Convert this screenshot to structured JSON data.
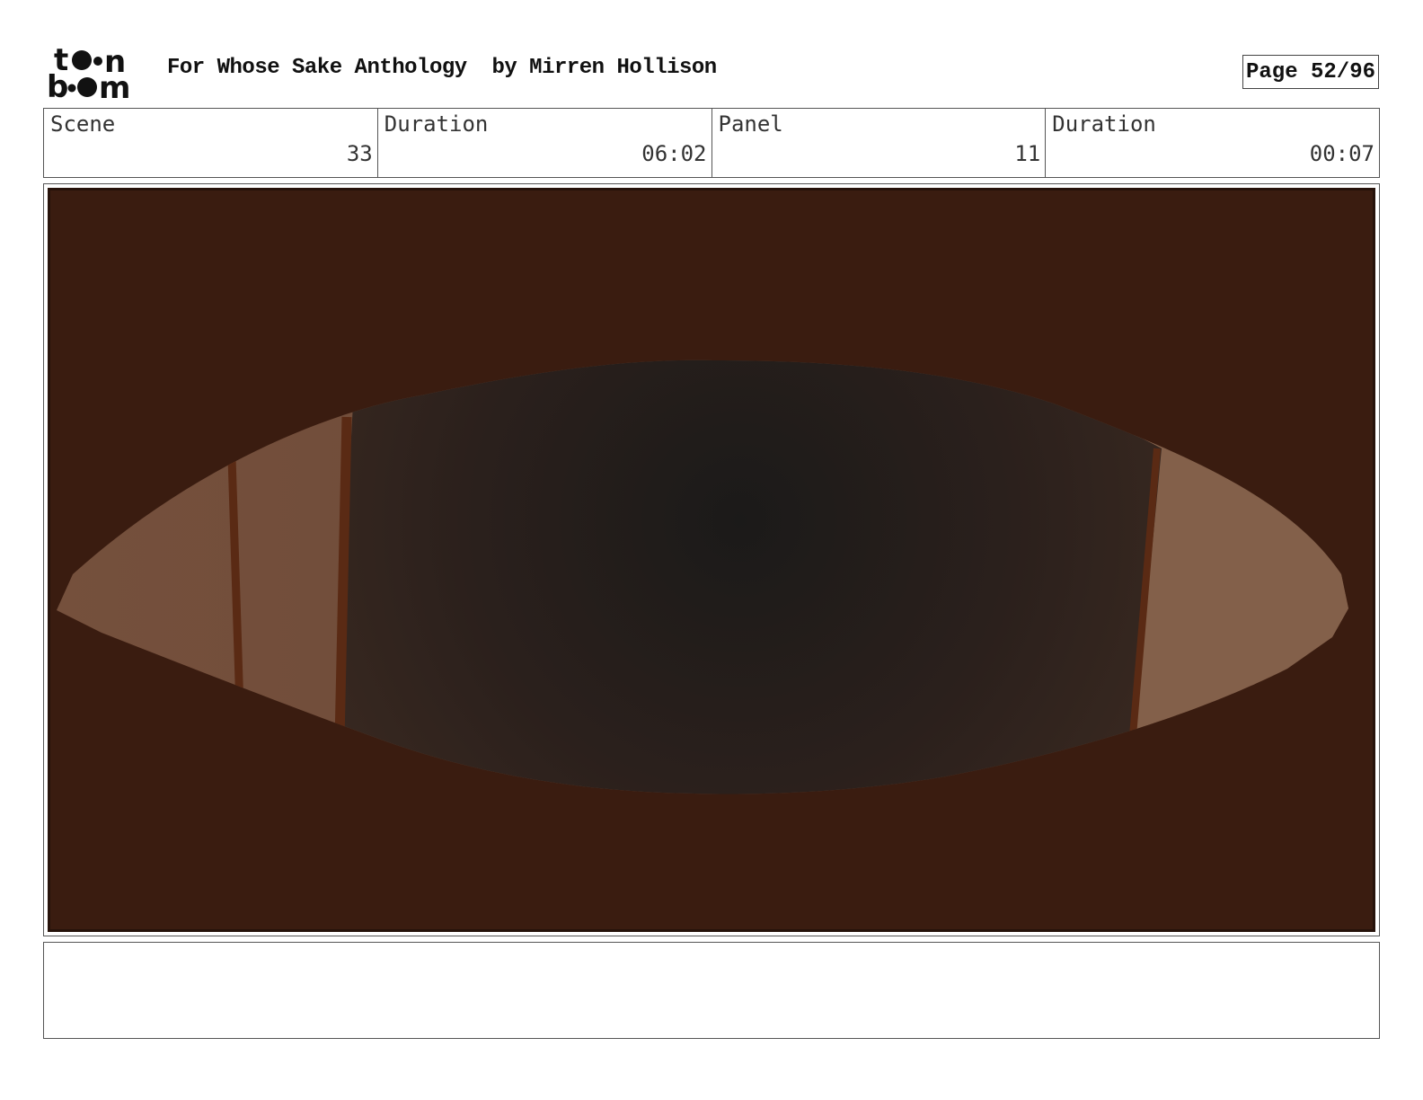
{
  "header": {
    "logo_alt": "toon boom",
    "title": "For Whose Sake Anthology  by Mirren Hollison",
    "page": "Page 52/96"
  },
  "info": {
    "scene_label": "Scene",
    "scene_value": "33",
    "scene_duration_label": "Duration",
    "scene_duration_value": "06:02",
    "panel_label": "Panel",
    "panel_value": "11",
    "panel_duration_label": "Duration",
    "panel_duration_value": "00:07"
  },
  "panel": {
    "description": "",
    "colors": {
      "background": "#3a1c10",
      "pupil_center": "#1b1a19",
      "pupil_edge": "#3b2a21",
      "sclera": "#6e4a38",
      "sclera_right": "#83604a",
      "vein": "#5a2a14"
    }
  },
  "notes": {
    "text": ""
  }
}
